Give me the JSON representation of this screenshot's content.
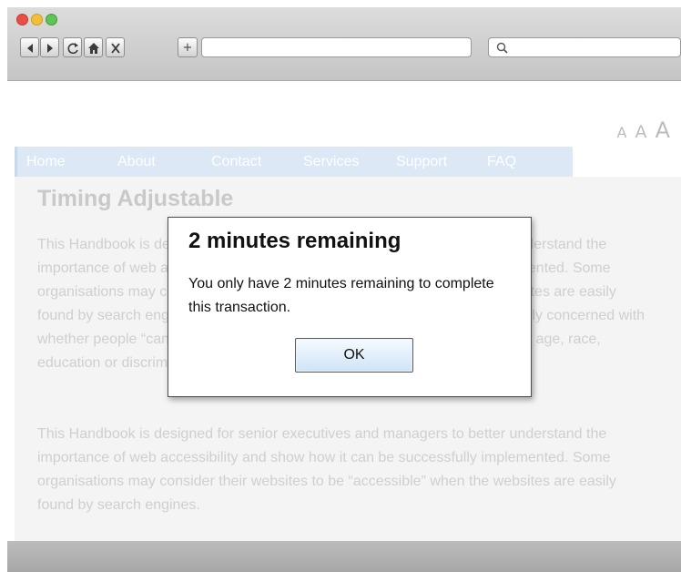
{
  "browser": {
    "window_controls": [
      "close",
      "minimize",
      "zoom"
    ],
    "toolbar": {
      "back_icon": "back-arrow-icon",
      "forward_icon": "forward-arrow-icon",
      "reload_icon": "reload-icon",
      "home_icon": "home-icon",
      "stop_icon": "close-icon",
      "new_tab_label": "+",
      "url_value": "",
      "search_icon": "search-icon",
      "search_value": ""
    }
  },
  "page": {
    "text_size": [
      "A",
      "A",
      "A"
    ],
    "nav": [
      "Home",
      "About",
      "Contact",
      "Services",
      "Support",
      "FAQ"
    ],
    "heading": "Timing Adjustable",
    "paragraph1": "This Handbook is designed for senior executives and managers to better understand the importance of web accessibility and show how it can be successfully implemented. Some organisations may consider their websites to be “accessible” when the websites are easily found by search engines. However, the concept of web accessibility is not only concerned with whether people “can find you”, it also includes people regardless of disability, age, race, education or discrimination.",
    "paragraph2": "This Handbook is designed for senior executives and managers to better understand the importance of web accessibility and show how it can be successfully implemented. Some organisations may consider their websites to be “accessible” when the websites are easily found by search engines."
  },
  "dialog": {
    "title": "2 minutes remaining",
    "message": "You only have 2 minutes remaining to complete this transaction.",
    "ok_label": "OK"
  }
}
